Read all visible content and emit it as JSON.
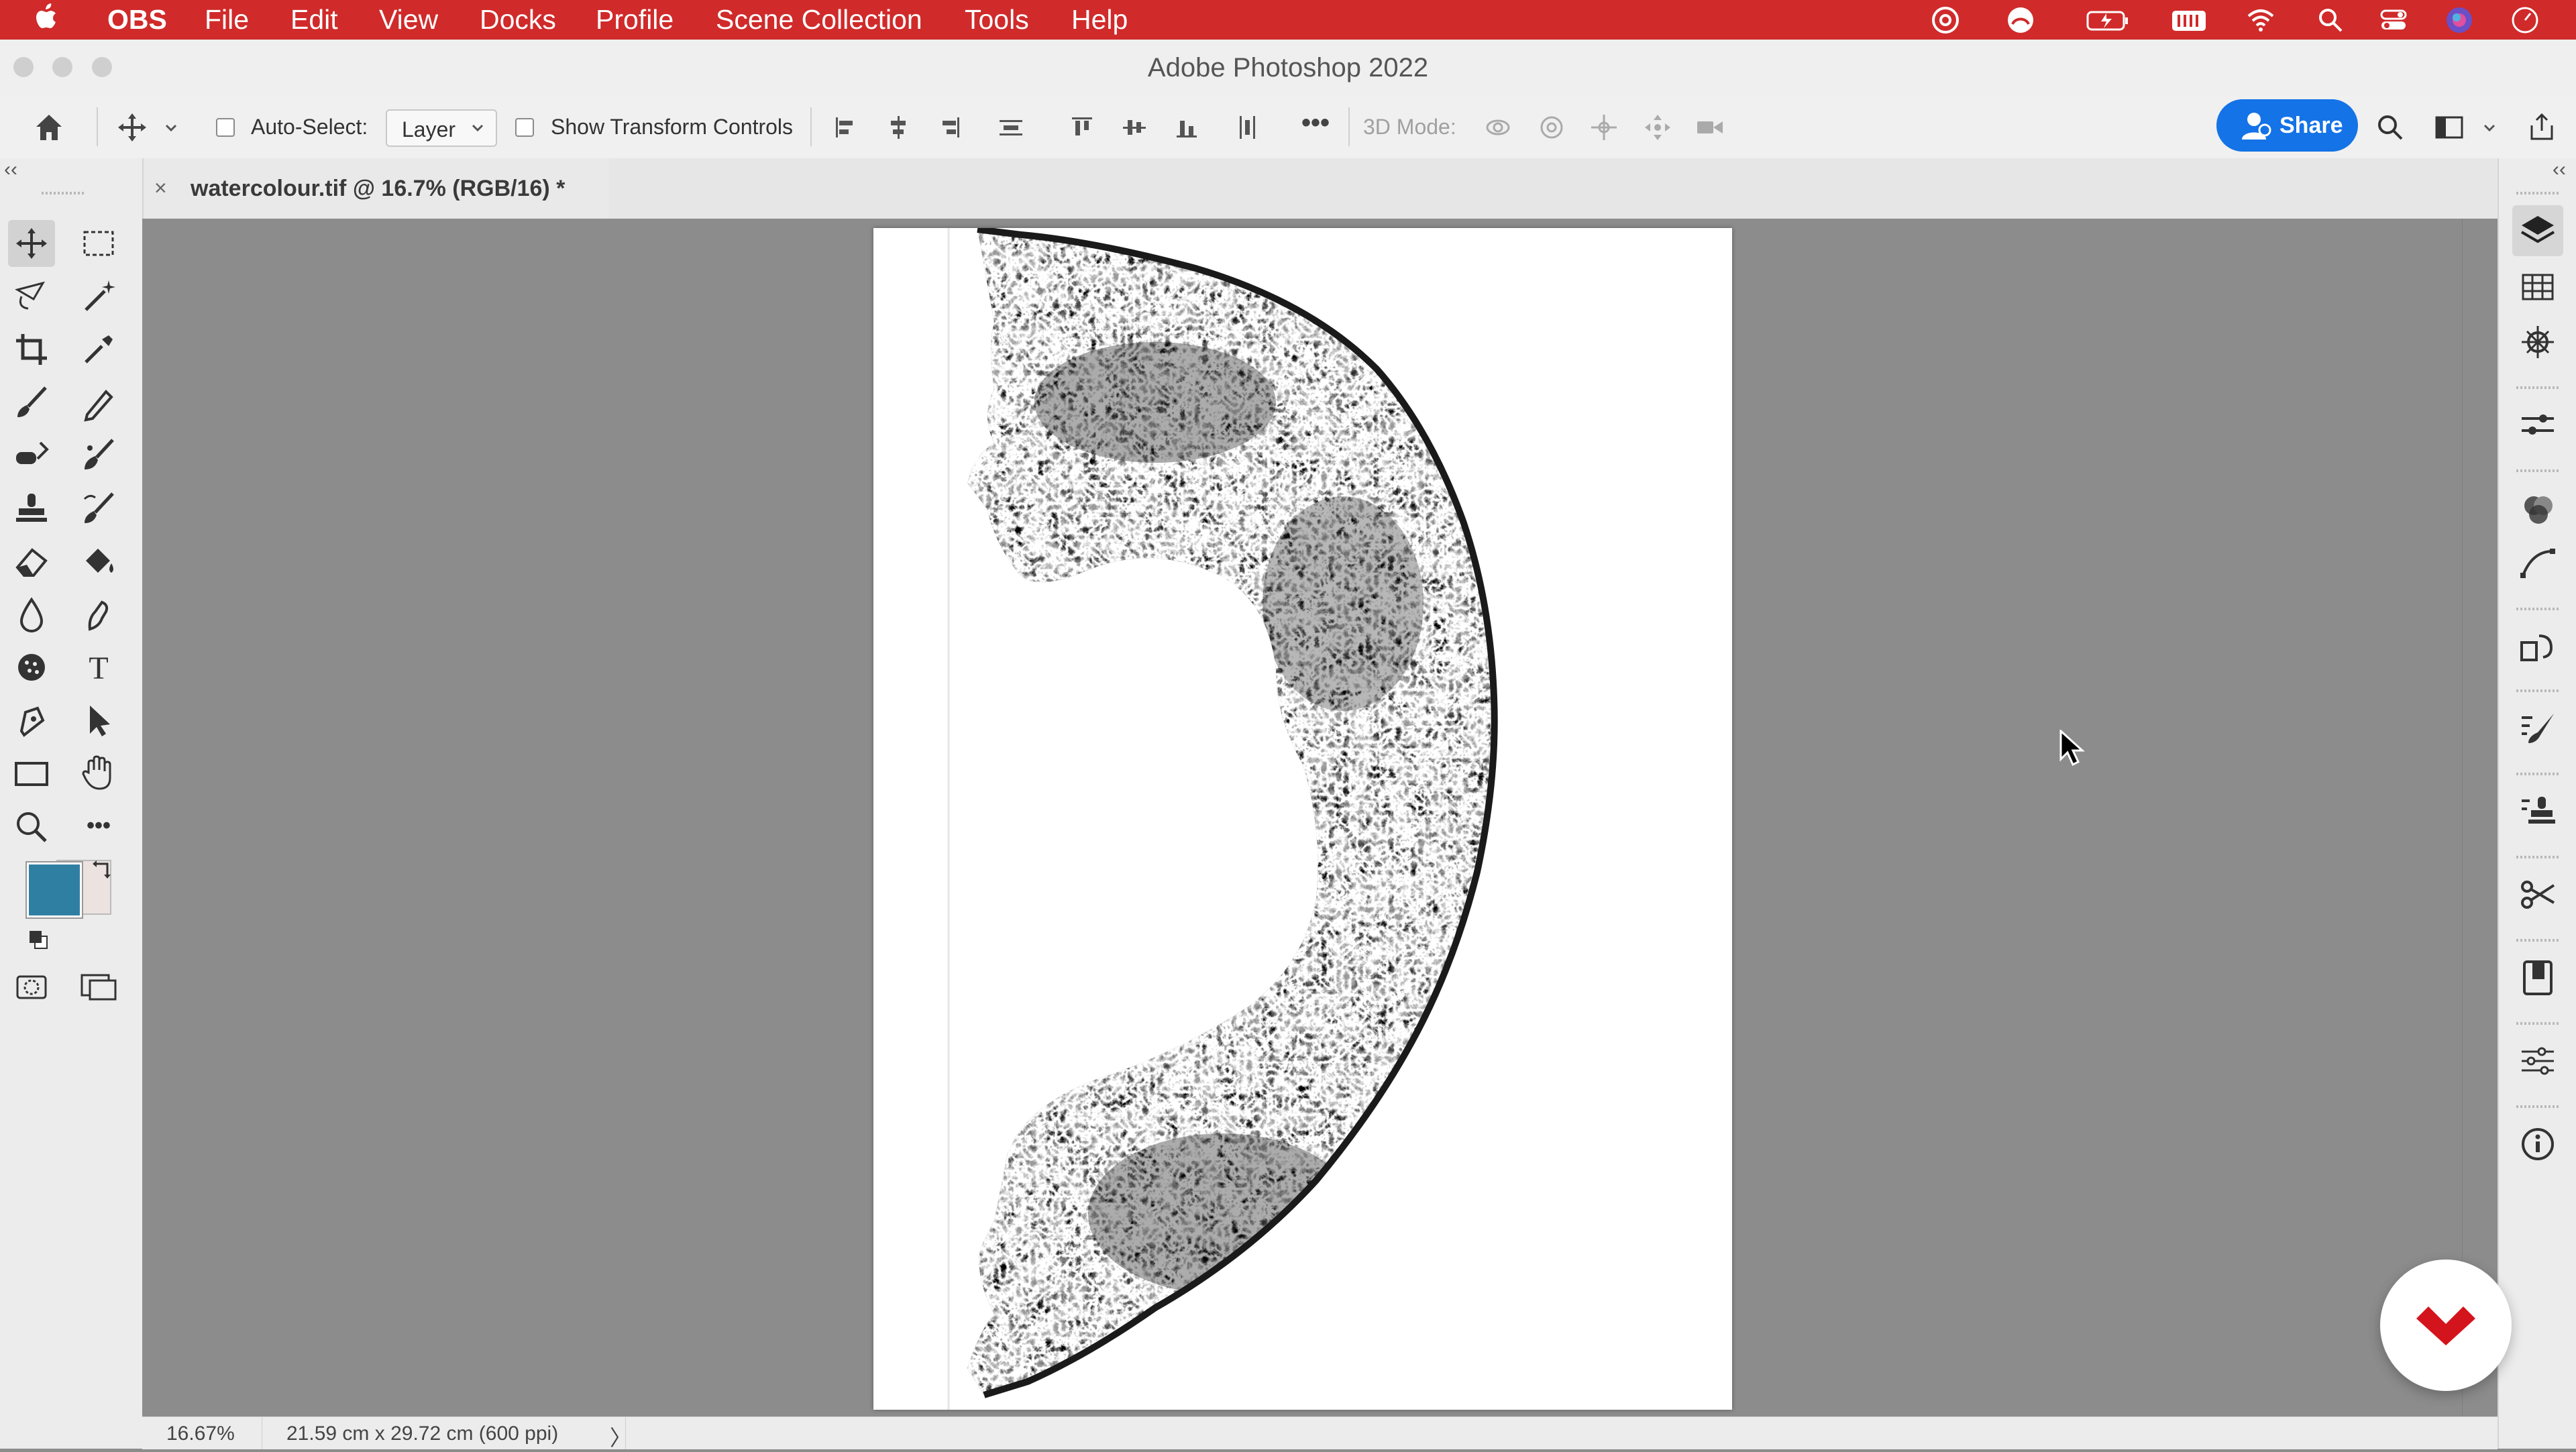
{
  "menubar": {
    "app": "OBS",
    "items": [
      "File",
      "Edit",
      "View",
      "Docks",
      "Profile",
      "Scene Collection",
      "Tools",
      "Help"
    ],
    "status_icons": [
      "creative-cloud-icon",
      "adobe-icon",
      "battery-icon",
      "keyboard-icon",
      "wifi-icon",
      "spotlight-icon",
      "control-center-icon",
      "siri-icon",
      "clock-icon"
    ]
  },
  "window": {
    "title": "Adobe Photoshop 2022"
  },
  "options_bar": {
    "auto_select_label": "Auto-Select:",
    "auto_select_value": "Layer",
    "show_transform_label": "Show Transform Controls",
    "more_label": "•••",
    "mode_3d_label": "3D Mode:",
    "share_label": "Share"
  },
  "document_tab": {
    "close": "×",
    "title": "watercolour.tif @ 16.7% (RGB/16) *"
  },
  "tools": [
    "move",
    "rectangular-marquee",
    "lasso",
    "magic-wand",
    "crop",
    "eyedropper",
    "brush",
    "pencil",
    "healing",
    "mixer-brush",
    "clone-stamp",
    "history-brush",
    "eraser",
    "paint-bucket",
    "blur",
    "smudge",
    "sponge",
    "type",
    "pen",
    "path-selection",
    "rectangle",
    "hand",
    "zoom",
    "more-tools"
  ],
  "colors": {
    "accent": "#d02a2a",
    "foreground": "#2f7fa3",
    "background": "#ece2e0",
    "share": "#1473e6",
    "badge": "#d4141c"
  },
  "tool_glyphs": {
    "type": "T",
    "more": "•••"
  },
  "panels": [
    "layers",
    "swatches",
    "navigator",
    "properties",
    "channels",
    "paths",
    "history",
    "brush-settings",
    "clone-source",
    "scissors",
    "libraries",
    "adjustments",
    "info"
  ],
  "status": {
    "zoom": "16.67%",
    "doc_info": "21.59 cm x 29.72 cm (600 ppi)",
    "arrow": "〉"
  }
}
